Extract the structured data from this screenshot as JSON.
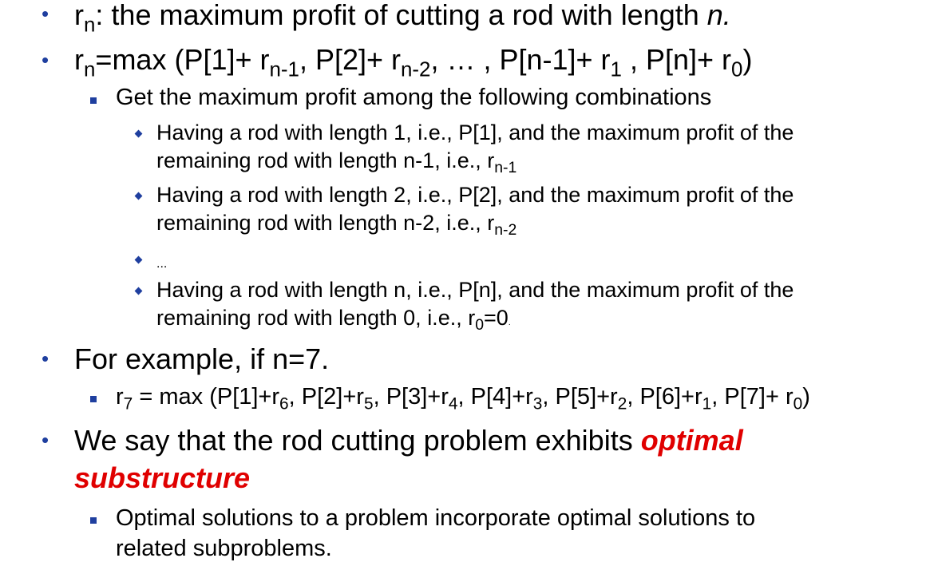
{
  "colors": {
    "bullet": "#1f3f9f",
    "emphasis": "#e00000"
  },
  "l1": {
    "r": "r",
    "n": "n",
    "text": ": the maximum profit of cutting a rod with length ",
    "ital": "n."
  },
  "l2": {
    "r": "r",
    "n": "n",
    "eq": "=max (P[1]+ r",
    "s1": "n-1",
    "t2": ", P[2]+ r",
    "s2": "n-2",
    "t3": ", … , P[n-1]+ r",
    "s3": "1",
    "t4": " , P[n]+ r",
    "s4": "0",
    "t5": ")"
  },
  "l3": {
    "text": "Get the maximum profit among the following combinations"
  },
  "l4": {
    "a": "Having a rod with length 1, i.e., P[1], and the maximum profit of the",
    "b": "remaining rod with length n-1, i.e., r",
    "bs": "n-1"
  },
  "l5": {
    "a": "Having a rod with length 2, i.e., P[2], and the maximum profit of the",
    "b": "remaining rod with length n-2, i.e., r",
    "bs": "n-2"
  },
  "l6": {
    "text": "..."
  },
  "l7": {
    "a": "Having a rod with length n, i.e., P[n], and the maximum profit of the",
    "b": "remaining rod with length 0, i.e., r",
    "bs": "0",
    "b2": "=0",
    "tail": "."
  },
  "l8": {
    "text": "For example, if n=7."
  },
  "l9": {
    "r": "r",
    "s7": "7",
    "t0": " = max (P[1]+r",
    "s6": "6",
    "t1": ", P[2]+r",
    "s5": "5",
    "t2": ", P[3]+r",
    "s4": "4",
    "t3": ", P[4]+r",
    "s3": "3",
    "t4": ", P[5]+r",
    "s2": "2",
    "t5": ", P[6]+r",
    "s1": "1",
    "t6": ", P[7]+ r",
    "s0": "0",
    "t7": ")"
  },
  "l10": {
    "text": "We say that the rod cutting problem exhibits ",
    "hl1": "optimal",
    "hl2": "substructure"
  },
  "l11": {
    "a": "Optimal solutions to a problem incorporate optimal solutions to",
    "b": "related subproblems."
  }
}
